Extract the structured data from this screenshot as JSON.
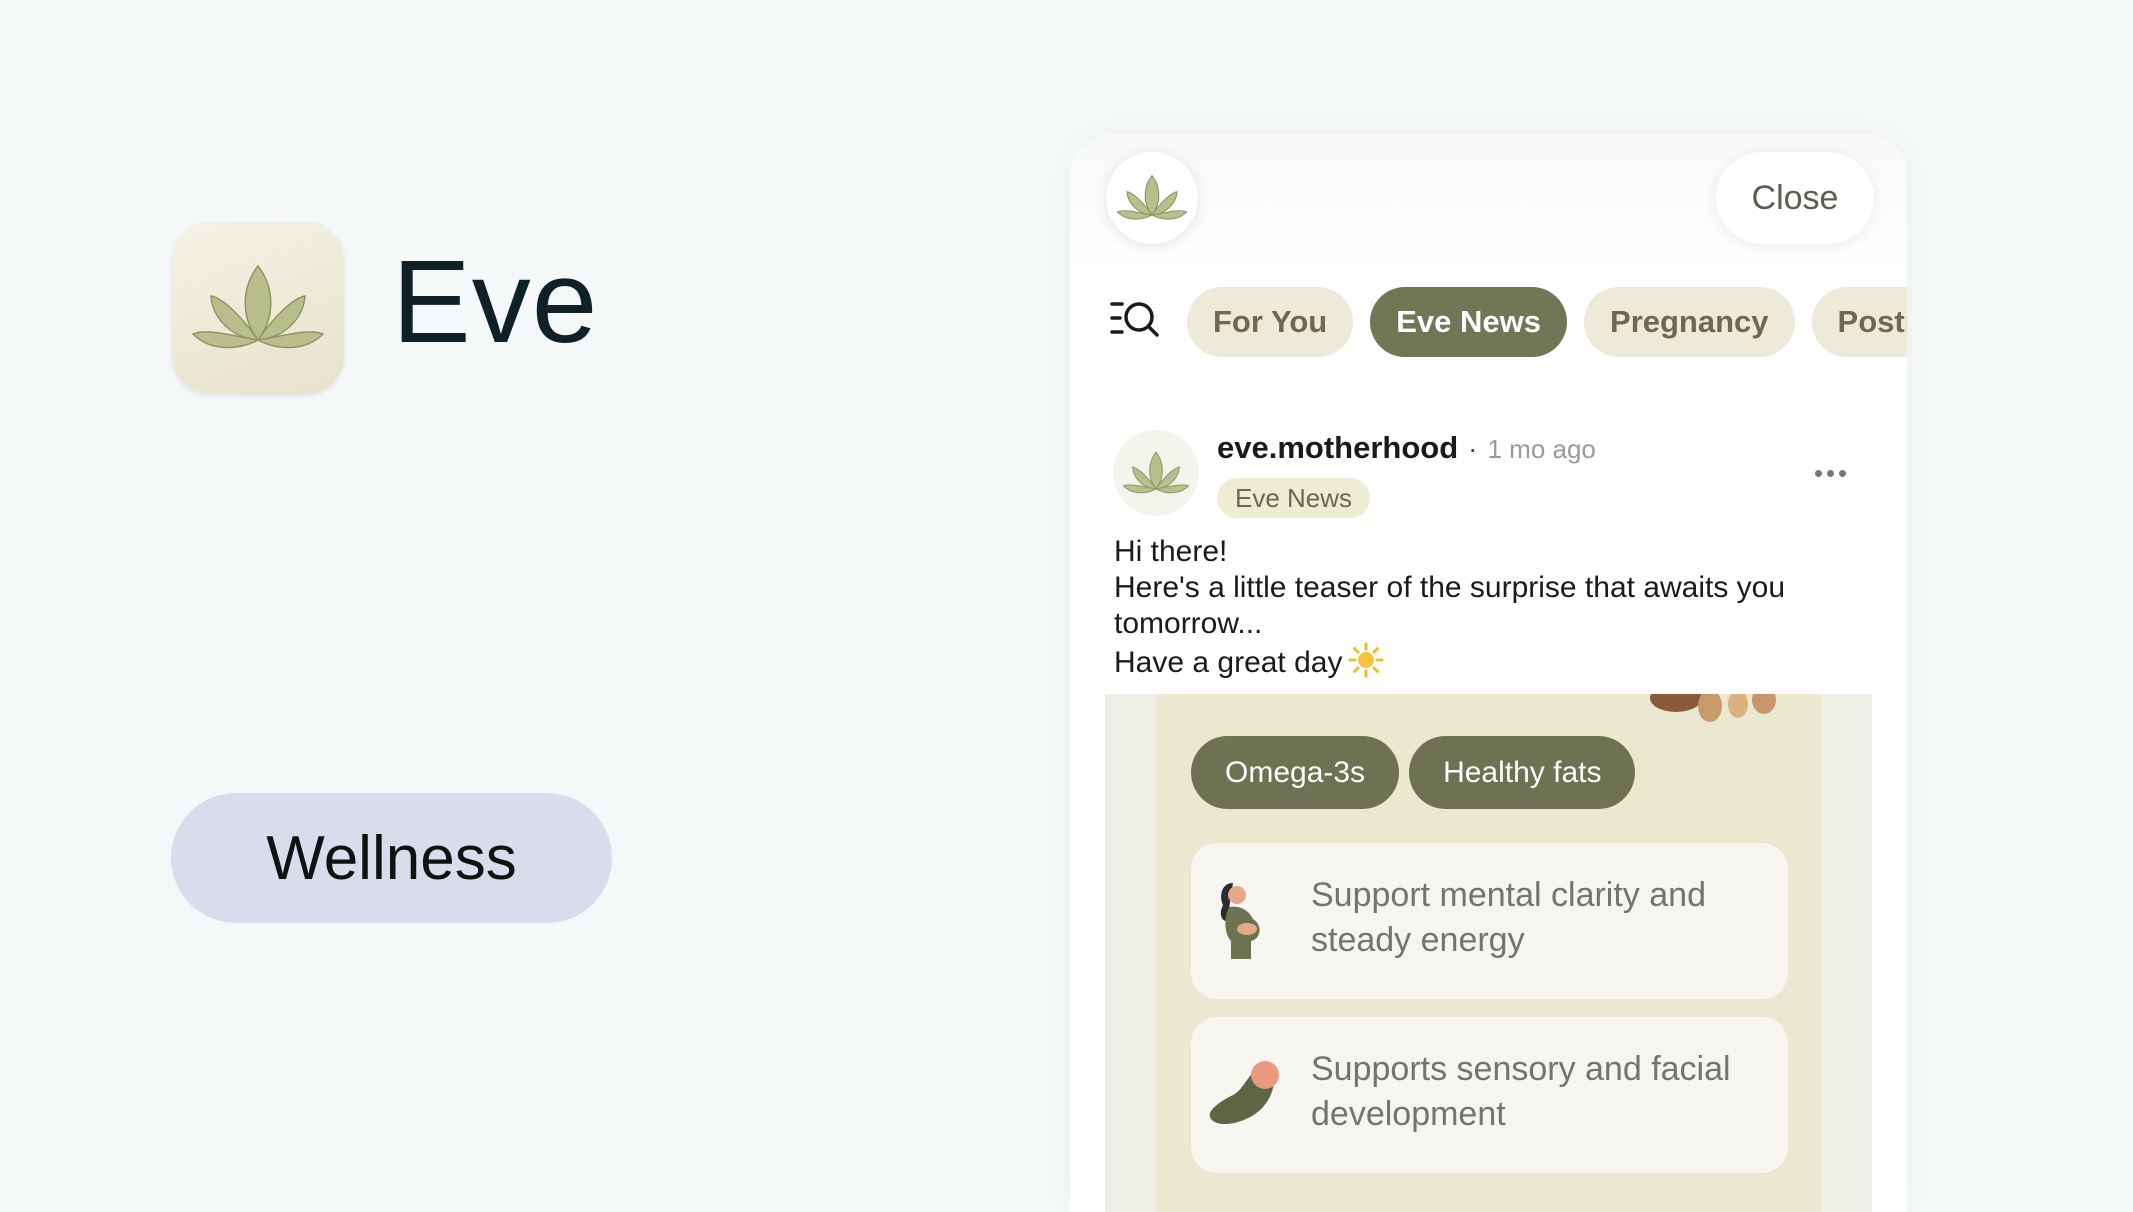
{
  "app": {
    "name": "Eve",
    "category": "Wellness"
  },
  "header": {
    "close_label": "Close"
  },
  "tabs": [
    {
      "label": "For You",
      "active": false
    },
    {
      "label": "Eve News",
      "active": true
    },
    {
      "label": "Pregnancy",
      "active": false
    },
    {
      "label": "Postna",
      "active": false
    }
  ],
  "post": {
    "author": "eve.motherhood",
    "separator": "·",
    "time": "1 mo ago",
    "tag": "Eve News",
    "lines": [
      "Hi there!",
      "Here's a little teaser of the surprise that awaits you",
      "tomorrow...",
      "Have a great day"
    ],
    "emoji": "sun-icon",
    "media": {
      "chips": [
        "Omega-3s",
        "Healthy fats"
      ],
      "cards": [
        {
          "text": "Support mental clarity and steady energy",
          "icon": "pregnant-woman-illustration"
        },
        {
          "text": "Supports sensory and facial development",
          "icon": "swaddled-baby-illustration"
        }
      ]
    }
  },
  "colors": {
    "background": "#f5f8f9",
    "accent": "#727556",
    "tab_inactive": "#eeeada",
    "category_pill": "#d8dcec"
  }
}
